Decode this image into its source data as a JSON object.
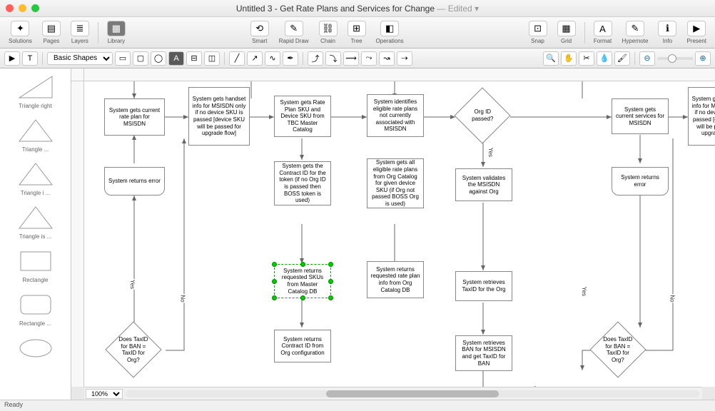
{
  "window": {
    "title_prefix": "Untitled 3 - ",
    "title_doc": "Get Rate Plans and Services for Change",
    "edited": " — Edited",
    "disclosure": "▾"
  },
  "toolbar": {
    "solutions": "Solutions",
    "pages": "Pages",
    "layers": "Layers",
    "library": "Library",
    "smart": "Smart",
    "rapid": "Rapid Draw",
    "chain": "Chain",
    "tree": "Tree",
    "operations": "Operations",
    "snap": "Snap",
    "grid": "Grid",
    "format": "Format",
    "hypernote": "Hypernote",
    "info": "Info",
    "present": "Present"
  },
  "secondbar": {
    "shapes_label": "Basic Shapes"
  },
  "sidebar": {
    "shapes": [
      "Triangle right",
      "Triangle ...",
      "Triangle i ...",
      "Triangle is ...",
      "Rectangle",
      "Rectangle ...",
      ""
    ]
  },
  "canvas": {
    "zoom": "100%",
    "nodes": {
      "n1": "System gets current rate plan for MSISDN",
      "n2": "System gets handset info for MSISDN only if no device SKU is passed [device SKU will be passed for upgrade flow]",
      "n3": "System gets Rate Plan SKU and Device SKU from TBC Master Catalog",
      "n4": "System identifies eligible rate plans not currently associated with MSISDN",
      "n5": "Org ID passed?",
      "n6": "System gets current services for MSISDN",
      "n7": "System gets handset info for MSISDN only if no device SKU is passed [device SKU will be passed for upgrade flow]",
      "n8": "System returns error",
      "n9": "System gets the Contract ID for the token (if no Org ID is passed then BOSS token is used)",
      "n10": "System gets all eligible rate plans from Org Catalog for given device SKU (if Org not passed BOSS Org is used)",
      "n11": "System validates the MSISDN against Org",
      "n12": "System returns error",
      "n13": "System returns requested SKUs from Master Catalog DB",
      "n14": "System returns requested rate plan info from Org Catalog DB",
      "n15": "System retrieves TaxID for the Org",
      "n16": "Does TaxID for BAN = TaxID for Org?",
      "n17": "System returns Contract ID from Org configuration",
      "n18": "System retrieves BAN for MSISDN and get TaxID for BAN",
      "n19": "Does TaxID for BAN = TaxID for Org?"
    },
    "labels": {
      "yes1": "Yes",
      "yes2": "Yes",
      "yes3": "Yes",
      "no1": "No",
      "no2": "No"
    }
  },
  "status": "Ready"
}
